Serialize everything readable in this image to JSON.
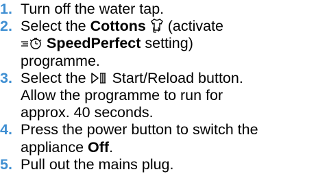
{
  "steps": [
    {
      "number": "1.",
      "text": "Turn off the water tap."
    },
    {
      "number": "2.",
      "text_a": "Select the ",
      "bold_cottons": "Cottons",
      "text_b": " (activate",
      "bold_speed": "SpeedPerfect",
      "text_c": " setting)",
      "text_d": "programme.",
      "icons": [
        "cottons-tshirt-icon",
        "speedperfect-clock-icon"
      ]
    },
    {
      "number": "3.",
      "text_a": "Select the ",
      "text_b": " Start/Reload button.",
      "text_c": "Allow the programme to run for",
      "text_d": "approx. 40 seconds.",
      "icons": [
        "start-reload-icon"
      ]
    },
    {
      "number": "4.",
      "text_a": "Press the power button to switch the",
      "text_b": "appliance ",
      "bold_off": "Off",
      "text_c": "."
    },
    {
      "number": "5.",
      "text": "Pull out the mains plug."
    }
  ],
  "colors": {
    "step_number": "#3f8fd2",
    "text": "#000000"
  }
}
